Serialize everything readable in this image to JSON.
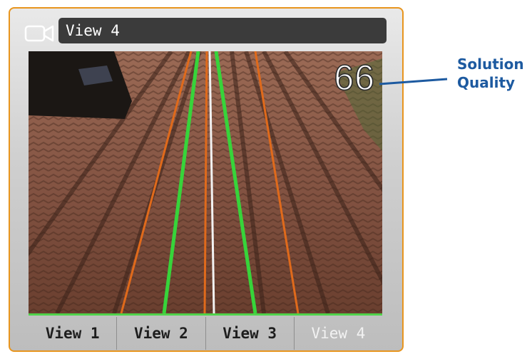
{
  "window": {
    "title": "View 4",
    "icon": "video-camera-icon"
  },
  "overlay": {
    "solution_quality_value": "66"
  },
  "tabs": [
    {
      "label": "View 1",
      "active": false
    },
    {
      "label": "View 2",
      "active": false
    },
    {
      "label": "View 3",
      "active": false
    },
    {
      "label": "View 4",
      "active": true
    }
  ],
  "callout": {
    "line1": "Solution",
    "line2": "Quality"
  },
  "colors": {
    "frame_border": "#e8951e",
    "guide_green": "#37d43a",
    "guide_orange": "#e06a1b",
    "center_white": "#f2f2f2",
    "callout_blue": "#1d5aa0"
  }
}
